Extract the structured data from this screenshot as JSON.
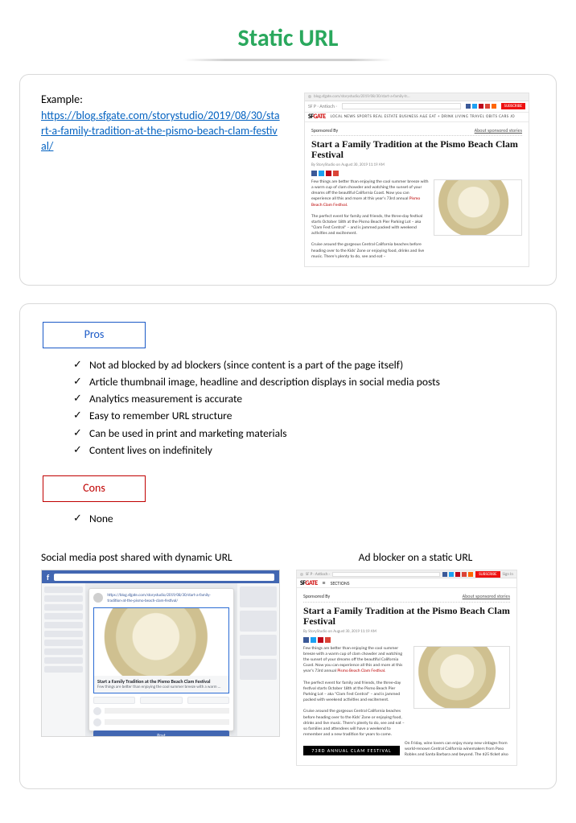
{
  "title": "Static URL",
  "example": {
    "label": "Example:",
    "url": "https://blog.sfgate.com/storystudio/2019/08/30/start-a-family-tradition-at-the-pismo-beach-clam-festival/"
  },
  "preview": {
    "logo_left": "SF",
    "logo_right": "GATE",
    "nav": "LOCAL   NEWS   SPORTS   REAL ESTATE   BUSINESS   A&E   EAT + DRINK   LIVING   TRAVEL   OBITS   CARS   JO",
    "sponsored_by": "Sponsored By",
    "sponsored_link": "About sponsored stories",
    "headline": "Start a Family Tradition at the Pismo Beach Clam Festival",
    "byline": "By StoryStudio on August 30, 2019 11:19 AM",
    "para1": "Few things are better than enjoying the cool summer breeze with a warm cup of clam chowder and watching the sunset of your dreams off the beautiful California Coast. Now you can experience all this and more at this year's 73rd annual ",
    "para1_hl": "Pismo Beach Clam Festival.",
    "para2": "The perfect event for family and friends, the three-day festival starts October 18th at the Pismo Beach Pier Parking Lot – aka \"Clam Fest Central\" – and is jammed packed with weekend activities and excitement.",
    "para3": "Cruise around the gorgeous Central California beaches before heading over to the Kids' Zone or enjoying food, drinks and live music. There's plenty to do, see and eat –",
    "para3_ext": " so families and attendees will have a weekend to remember and a new tradition for years to come.",
    "para4": "On Friday, wine lovers can enjoy many new vintages from world-renown Central California winemakers from Paso Robles and Santa Barbara and beyond. The $25 ticket also",
    "banner": "73RD ANNUAL CLAM FESTIVAL",
    "sections_label": "SECTIONS",
    "subscribe": "SUBSCRIBE",
    "signin": "Sign In"
  },
  "pros": {
    "label": "Pros",
    "items": [
      "Not ad blocked by ad blockers (since content is a part of the page itself)",
      "Article thumbnail image, headline and description displays in social media posts",
      "Analytics measurement is accurate",
      "Easy to remember URL structure",
      "Can be used in print and marketing materials",
      "Content lives on indefinitely"
    ]
  },
  "cons": {
    "label": "Cons",
    "items": [
      "None"
    ]
  },
  "shots": {
    "left_label": "Social media post shared with dynamic URL",
    "right_label": "Ad blocker on a static URL"
  },
  "fb": {
    "share_url": "https://blog.sfgate.com/storystudio/2019/08/30/start-a-family-tradition-at-the-pismo-beach-clam-festival/",
    "card_title": "Start a Family Tradition at the Pismo Beach Clam Festival",
    "card_desc": "Few things are better than enjoying the cool summer breeze with a warm ...",
    "post_btn": "Post"
  }
}
